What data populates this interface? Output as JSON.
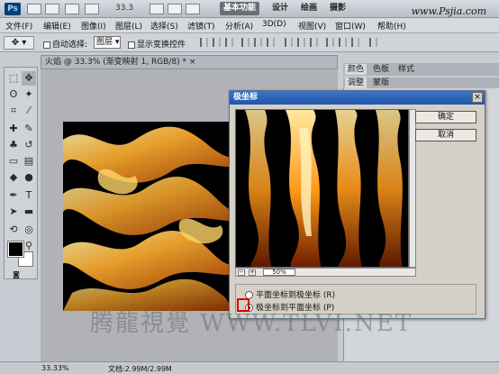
{
  "appbar": {
    "logo": "Ps",
    "zoom": "33.3",
    "workspaces": [
      "基本功能",
      "设计",
      "绘画",
      "摄影"
    ],
    "site": "www.Psjia.com"
  },
  "menu": [
    "文件(F)",
    "编辑(E)",
    "图像(I)",
    "图层(L)",
    "选择(S)",
    "滤镜(T)",
    "分析(A)",
    "3D(D)",
    "视图(V)",
    "窗口(W)",
    "帮助(H)"
  ],
  "options": {
    "auto_select": "自动选择:",
    "auto_select_value": "图层",
    "show_transform": "显示变换控件"
  },
  "document": {
    "tab_title": "火焰 @ 33.3% (渐变映射 1, RGB/8) *"
  },
  "panels": {
    "row1": [
      "颜色",
      "色板",
      "样式"
    ],
    "row2": [
      "调整",
      "蒙版"
    ]
  },
  "dialog": {
    "title": "极坐标",
    "ok": "确定",
    "cancel": "取消",
    "zoom": "50%",
    "option1": "平面坐标到极坐标 (R)",
    "option2": "极坐标到平面坐标 (P)",
    "selected": 2
  },
  "status": {
    "zoom": "33.33%",
    "doc": "文档:2.99M/2.99M"
  },
  "watermark_bottom": "腾龍視覺 WWW.TLVI.NET",
  "colors": {
    "fire": "#ff9a1a",
    "accent": "#e00000"
  }
}
